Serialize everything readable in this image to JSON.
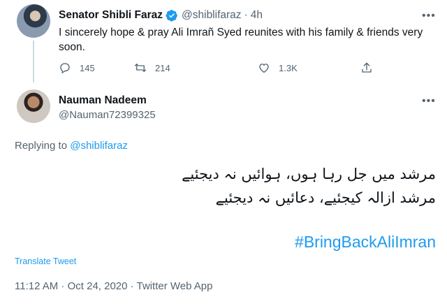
{
  "parent_tweet": {
    "name": "Senator Shibli Faraz",
    "handle": "@shiblifaraz",
    "separator": "·",
    "time": "4h",
    "text": "I sincerely hope & pray Ali Imrañ Syed reunites with his family & friends very soon.",
    "more": "•••",
    "stats": {
      "replies": "145",
      "retweets": "214",
      "likes": "1.3K"
    }
  },
  "reply_tweet": {
    "name": "Nauman Nadeem",
    "handle": "@Nauman72399325",
    "more": "•••",
    "replying_prefix": "Replying to ",
    "replying_to": "@shiblifaraz",
    "urdu_line_1": "مرشد میں جل رہا ہوں، ہوائیں نہ دیجئیے",
    "urdu_line_2": "مرشد ازالہ کیجئیے، دعائیں نہ دیجئیے",
    "hashtag": "#BringBackAliImran",
    "translate_label": "Translate Tweet",
    "timestamp": "11:12 AM · Oct 24, 2020 · Twitter Web App"
  },
  "icons": {
    "reply": "reply-icon",
    "retweet": "retweet-icon",
    "like": "heart-icon",
    "share": "share-icon",
    "verified": "verified-badge-icon"
  },
  "colors": {
    "accent": "#1d9bf0",
    "secondary_text": "#536471",
    "primary_text": "#0f1419"
  }
}
